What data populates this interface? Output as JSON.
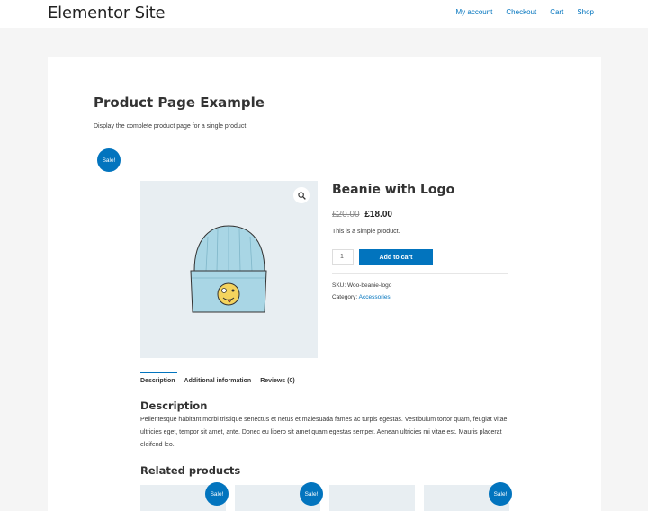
{
  "header": {
    "site_title": "Elementor Site",
    "nav": [
      {
        "label": "My account"
      },
      {
        "label": "Checkout"
      },
      {
        "label": "Cart"
      },
      {
        "label": "Shop"
      }
    ]
  },
  "page": {
    "title": "Product Page Example",
    "description": "Display the complete product page for a single product"
  },
  "product": {
    "sale_badge": "Sale!",
    "title": "Beanie with Logo",
    "old_price": "£20.00",
    "new_price": "£18.00",
    "short_description": "This is a simple product.",
    "quantity": "1",
    "add_to_cart_label": "Add to cart",
    "sku_label": "SKU: ",
    "sku": "Woo-beanie-logo",
    "category_label": "Category: ",
    "category": "Accessories",
    "zoom_icon": "magnifier-icon"
  },
  "tabs": [
    {
      "label": "Description"
    },
    {
      "label": "Additional information"
    },
    {
      "label": "Reviews (0)"
    }
  ],
  "description": {
    "title": "Description",
    "body": "Pellentesque habitant morbi tristique senectus et netus et malesuada fames ac turpis egestas. Vestibulum tortor quam, feugiat vitae, ultricies eget, tempor sit amet, ante. Donec eu libero sit amet quam egestas semper. Aenean ultricies mi vitae est. Mauris placerat eleifend leo."
  },
  "related": {
    "title": "Related products",
    "sale_badge": "Sale!"
  },
  "colors": {
    "accent": "#0274be",
    "page_bg": "#f5f5f5",
    "image_bg": "#e8eef2",
    "beanie": "#a9d6e5"
  }
}
